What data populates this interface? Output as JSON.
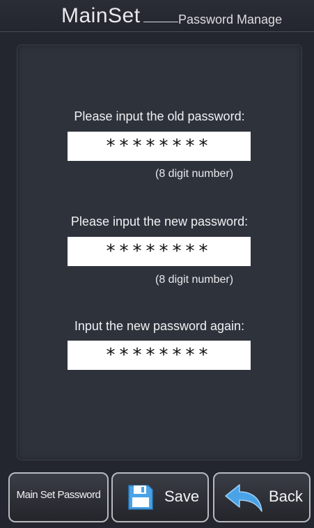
{
  "header": {
    "title": "MainSet",
    "subtitle": "Password Manage"
  },
  "form": {
    "old_label": "Please input the old password:",
    "old_value": "********",
    "old_hint": "(8 digit number)",
    "new_label": "Please input the new password:",
    "new_value": "********",
    "new_hint": "(8 digit number)",
    "confirm_label": "Input the new password again:",
    "confirm_value": "********"
  },
  "buttons": {
    "main_set_password": "Main Set Password",
    "save": "Save",
    "back": "Back"
  },
  "icons": {
    "save": "floppy-disk-icon",
    "back": "back-arrow-icon"
  },
  "colors": {
    "accent_blue": "#4aa3e6",
    "background": "#23262e",
    "panel": "#2e323b"
  }
}
